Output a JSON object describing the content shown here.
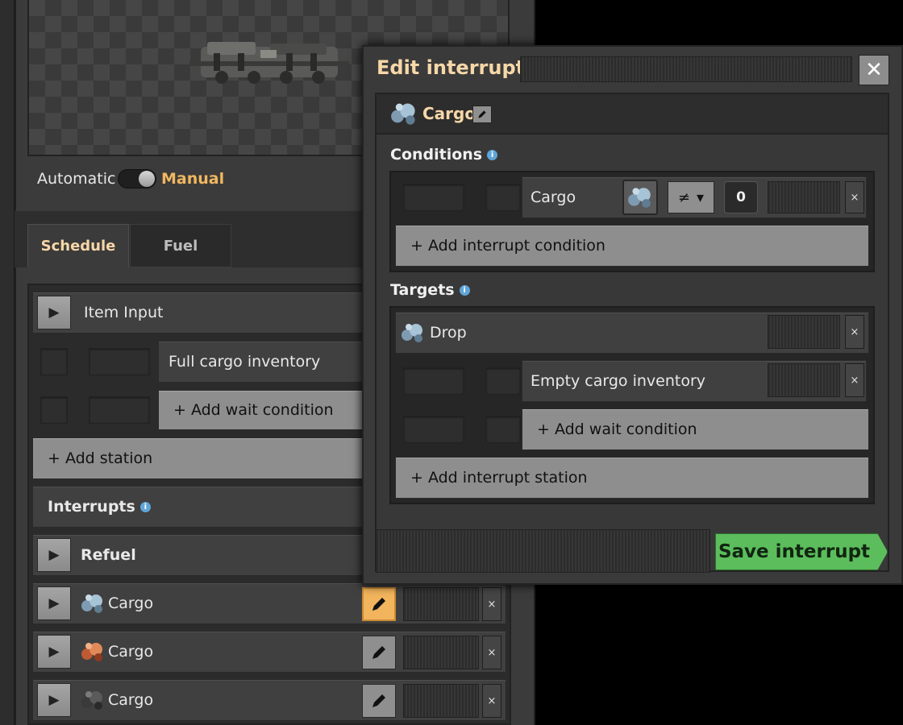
{
  "train": {
    "mode_automatic": "Automatic",
    "mode_manual": "Manual",
    "tabs": {
      "schedule": "Schedule",
      "fuel": "Fuel"
    }
  },
  "schedule": {
    "station_name": "Item Input",
    "wait_condition": "Full cargo inventory",
    "add_wait_condition": "+ Add wait condition",
    "add_station": "+ Add station",
    "interrupts_label": "Interrupts",
    "interrupts": [
      {
        "name": "Refuel",
        "icon": "none"
      },
      {
        "name": "Cargo",
        "icon": "iron-ore-icon",
        "editing": true
      },
      {
        "name": "Cargo",
        "icon": "copper-ore-icon"
      },
      {
        "name": "Cargo",
        "icon": "coal-icon"
      }
    ]
  },
  "dialog": {
    "title": "Edit interrupt",
    "interrupt_name": "Cargo",
    "conditions_label": "Conditions",
    "condition": {
      "label": "Cargo",
      "operator": "≠",
      "value": "0",
      "item_icon": "iron-ore-icon"
    },
    "add_interrupt_condition": "+ Add interrupt condition",
    "targets_label": "Targets",
    "target": {
      "name": "Drop",
      "icon": "iron-ore-icon",
      "wait_condition": "Empty cargo inventory",
      "add_wait_condition": "+ Add wait condition"
    },
    "add_interrupt_station": "+ Add interrupt station",
    "save_label": "Save interrupt",
    "close_glyph": "✕"
  },
  "glyphs": {
    "play": "▶",
    "x": "×",
    "dropdown": "▾",
    "info": "i"
  },
  "colors": {
    "accent_orange": "#f0b860",
    "title_cream": "#f6d7a8",
    "save_green": "#5bbd5b",
    "pencil_active": "#f2b45c"
  }
}
